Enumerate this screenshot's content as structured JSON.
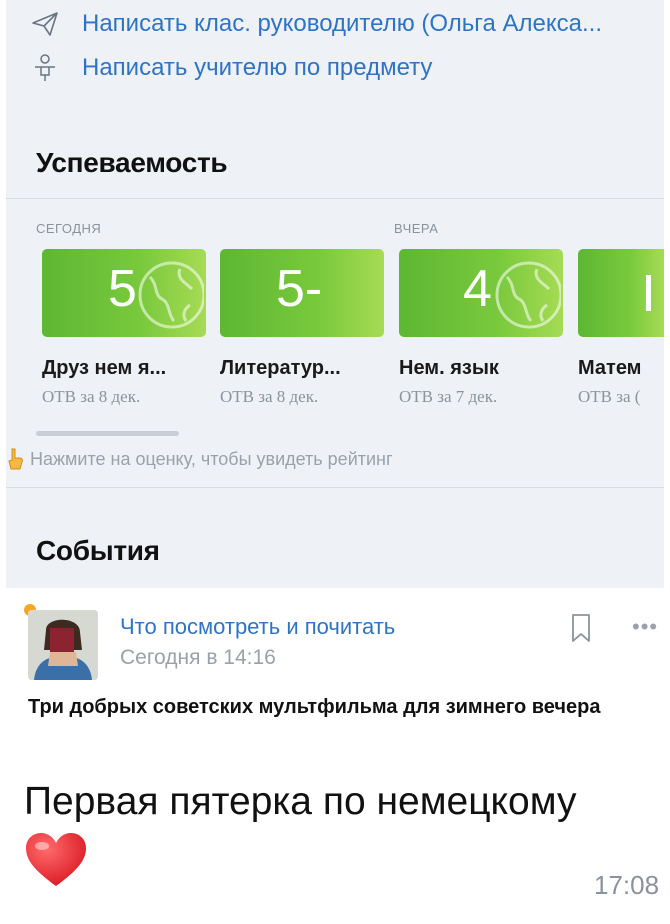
{
  "contacts": {
    "class_teacher": "Написать клас. руководителю (Ольга Алекса...",
    "subject_teacher": "Написать учителю по предмету"
  },
  "grades": {
    "title": "Успеваемость",
    "today_label": "СЕГОДНЯ",
    "yesterday_label": "ВЧЕРА",
    "items": [
      {
        "mark": "5",
        "subject": "Друз нем я...",
        "date": "ОТВ за 8 дек."
      },
      {
        "mark": "5-",
        "subject": "Литератур...",
        "date": "ОТВ за 8 дек."
      },
      {
        "mark": "4",
        "subject": "Нем. язык",
        "date": "ОТВ за 7 дек."
      },
      {
        "mark": "",
        "subject": "Матем",
        "date": "ОТВ за ("
      }
    ],
    "hint": "Нажмите на оценку, чтобы увидеть рейтинг",
    "tile_colors": [
      "#5db733",
      "#a6db55"
    ]
  },
  "events": {
    "title": "События",
    "channel": "Что посмотреть и почитать",
    "time": "Сегодня в 14:16",
    "headline": "Три добрых советских мультфильма для зимнего вечера"
  },
  "message": {
    "text": "Первая пятерка по немецкому",
    "time": "17:08"
  },
  "accent_color": "#2f73c4"
}
